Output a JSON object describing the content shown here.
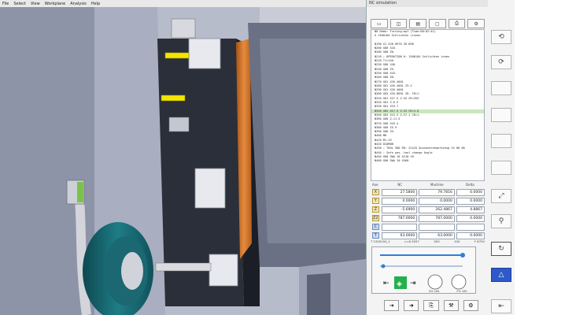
{
  "menu": [
    "File",
    "Select",
    "View",
    "Workplane",
    "Analysis",
    "Help"
  ],
  "panel": {
    "title": "NC simulation",
    "toolbar_icons": [
      "machine-icon",
      "program-icon",
      "keyboard-icon",
      "blank-icon",
      "print-icon",
      "settings-icon"
    ],
    "program_lines": [
      "N0 Demo: Turning.mpf  (Time:00:02:41)",
      "G 1500104 Schlichten (innen",
      "",
      "N190 G1 X26.0978 Z6.898",
      "N200 G00 X16.",
      "N200 G00 Z0.",
      "N210 ; OPERATION 6: 1500104 Schlichten innen",
      "N220 T1=140",
      "N230 G00 X40",
      "N240 G00 Z5.",
      "N250 G00 X16.",
      "N260 G00 Z0.",
      "N270 G01 X26.4001",
      "N280 G01 X26.4001 Z3.2",
      "N290 G01 X26.4001",
      "N300 G03 X26.8601 Z0. CR=1.",
      "N310 G01 X27.5 Z-55 CR=355",
      "N320 G01 Z-6.5",
      "N330 G01 X19.7",
      "N340 G02 X17.5 Z-53 CR=3.6",
      "N350 G03 X15.5 Z-57.1 CR=1.",
      "N360 G00 Z-11.5",
      "N370 G00 X16.4",
      "N380 G00 Z5.9",
      "N390 G00 Z5.",
      "N400 M8",
      "N410 M1.19",
      "N420 DIAMON",
      "N430 ; TOOL 500 RD: 22x25 Aussendrehwerkzeug 15 00 08",
      "N440 ; Safe pos. tool change Angle",
      "N450 G00 SWA 10 X210 Y0",
      "N460 G00 SWA 10 X560"
    ],
    "highlight_index": 19,
    "coord_headers": {
      "axis": "Axe",
      "nc": "NC",
      "machine": "Machine",
      "delta": "Delta"
    },
    "coords": [
      {
        "axis": "X",
        "nc": "27.5800",
        "machine": "79.7816",
        "delta": "0.0000",
        "blue": false
      },
      {
        "axis": "Y",
        "nc": "0.0000",
        "machine": "0.0000",
        "delta": "0.0000",
        "blue": false
      },
      {
        "axis": "Z",
        "nc": "-5.6900",
        "machine": "262.4867",
        "delta": "4.8867",
        "blue": false
      },
      {
        "axis": "Z2",
        "nc": "787.0000",
        "machine": "787.0000",
        "delta": "0.0000",
        "blue": false
      },
      {
        "axis": "C",
        "nc": "",
        "machine": "",
        "delta": "",
        "blue": true
      },
      {
        "axis": "T",
        "nc": "63.0000",
        "machine": "63.0000",
        "delta": "0.0000",
        "blue": true
      }
    ],
    "status": {
      "tool": "T 1500104_1",
      "speed": "c=6.3057",
      "feed": "500",
      "units": "100",
      "ftime": "F 6750"
    },
    "controls": {
      "speed_label": "S%",
      "speed_value": "100",
      "feed_label": "F%",
      "feed_value": "100"
    },
    "bottom_icons": [
      "step-icon",
      "run-icon",
      "export-icon",
      "tool-icon",
      "gear-icon"
    ]
  },
  "right_column": [
    {
      "name": "rotate-icon",
      "glyph": "⟲"
    },
    {
      "name": "redo-icon",
      "glyph": "⟳"
    },
    {
      "name": "blank-button",
      "glyph": ""
    },
    {
      "name": "blank-button",
      "glyph": ""
    },
    {
      "name": "blank-button",
      "glyph": ""
    },
    {
      "name": "blank-button",
      "glyph": ""
    },
    {
      "name": "tool-change-icon",
      "glyph": "⤢"
    },
    {
      "name": "probe-icon",
      "glyph": "⚲"
    },
    {
      "name": "cycle-icon",
      "glyph": "↻"
    },
    {
      "name": "up-triangle-icon",
      "glyph": "△"
    },
    {
      "name": "collapse-icon",
      "glyph": "⇤"
    }
  ],
  "colors": {
    "teal": "#1a6f7a",
    "orange": "#d4782c",
    "ui_blue": "#2e59c9",
    "green": "#22b14c",
    "yellow": "#f3e500"
  }
}
